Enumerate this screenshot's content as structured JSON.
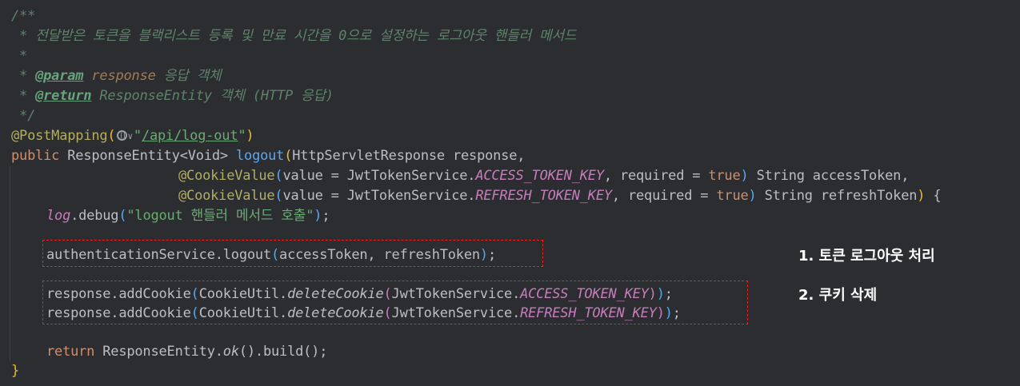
{
  "code": {
    "doc_open": "/**",
    "doc_desc": " * 전달받은 토큰을 블랙리스트 등록 및 만료 시간을 0으로 설정하는 로그아웃 핸들러 메서드",
    "doc_blank": " *",
    "doc_param_prefix": " * ",
    "doc_param_tag": "@param",
    "doc_param_name": "response",
    "doc_param_desc": " 응답 객체",
    "doc_return_prefix": " * ",
    "doc_return_tag": "@return",
    "doc_return_desc": " ResponseEntity 객체 (HTTP 응답)",
    "doc_close": " */",
    "mapping_annotation": "@PostMapping",
    "mapping_open": "(",
    "mapping_quote_open": "\"",
    "mapping_path": "/api/log-out",
    "mapping_quote_close": "\"",
    "mapping_close": ")",
    "sig_public": "public",
    "sig_return_type": " ResponseEntity<Void> ",
    "sig_method": "logout",
    "sig_open": "(",
    "sig_param1": "HttpServletResponse response,",
    "cookie_annot": "@CookieValue",
    "cookie1_open": "(",
    "cookie1_value": "value = JwtTokenService.",
    "cookie1_const": "ACCESS_TOKEN_KEY",
    "cookie1_required": ", required = ",
    "cookie1_true": "true",
    "cookie1_close": ")",
    "cookie1_tail": " String accessToken,",
    "cookie2_open": "(",
    "cookie2_value": "value = JwtTokenService.",
    "cookie2_const": "REFRESH_TOKEN_KEY",
    "cookie2_required": ", required = ",
    "cookie2_true": "true",
    "cookie2_close": ")",
    "cookie2_tail": " String refreshToken",
    "sig_close": ")",
    "sig_brace": " {",
    "log_obj": "log",
    "log_call": ".debug",
    "log_open": "(",
    "log_str": "\"logout 핸들러 메서드 호출\"",
    "log_close": ")",
    "log_semi": ";",
    "auth_call": "authenticationService.logout",
    "auth_open": "(",
    "auth_args": "accessToken, refreshToken",
    "auth_close": ")",
    "auth_semi": ";",
    "resp_prefix": "response.addCookie",
    "resp_open": "(",
    "resp_util": "CookieUtil.",
    "resp_delete": "deleteCookie",
    "resp_inner_open": "(",
    "resp_service": "JwtTokenService.",
    "resp1_const": "ACCESS_TOKEN_KEY",
    "resp2_const": "REFRESH_TOKEN_KEY",
    "resp_inner_close": ")",
    "resp_close": ")",
    "resp_semi": ";",
    "return_kw": "return",
    "return_type": " ResponseEntity.",
    "return_ok": "ok",
    "return_rest": "().build();",
    "closing_brace": "}"
  },
  "annotations": {
    "note1": "1. 토큰 로그아웃 처리",
    "note2": "2. 쿠키 삭제"
  },
  "colors": {
    "background": "#2b2d30",
    "highlight_box": "#ff1a1a",
    "note_text": "#ffffff"
  },
  "icons": [
    "globe-icon",
    "chevron-down-icon"
  ]
}
